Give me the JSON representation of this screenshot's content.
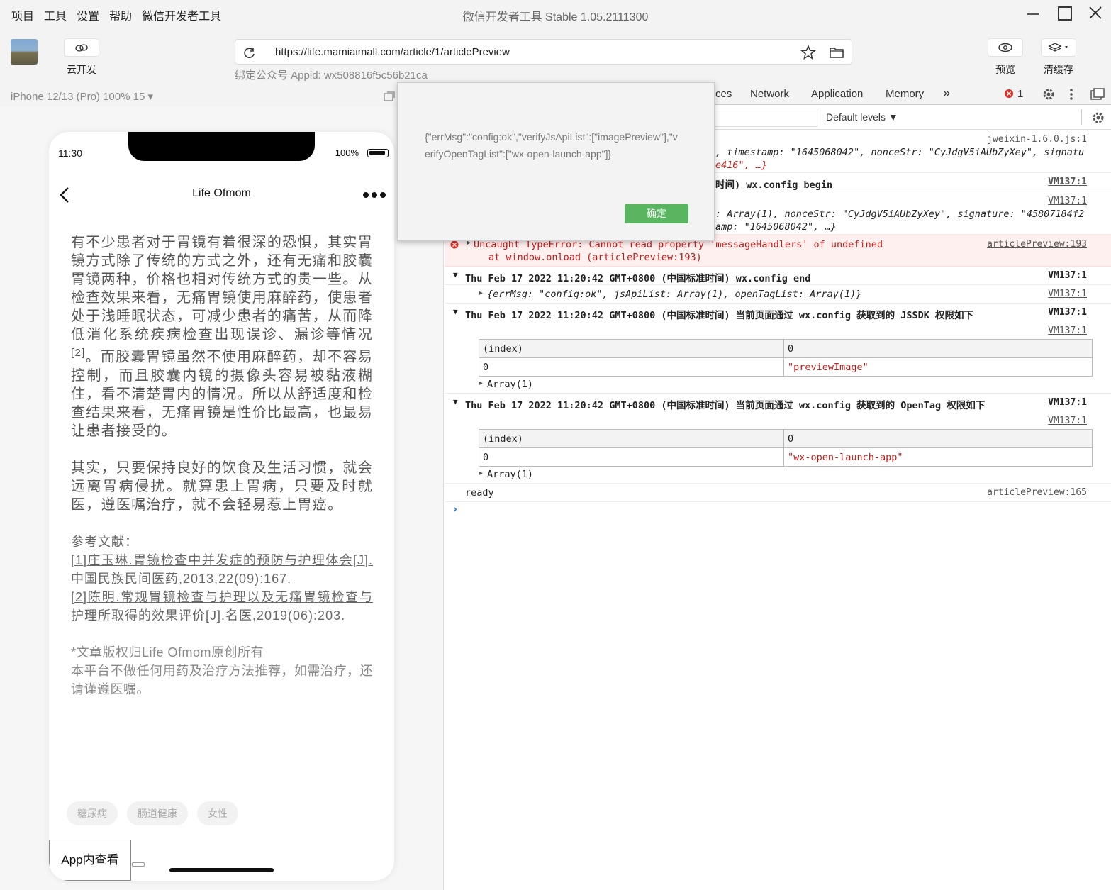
{
  "menu": [
    "项目",
    "工具",
    "设置",
    "帮助",
    "微信开发者工具"
  ],
  "window_title": "微信开发者工具 Stable 1.05.2111300",
  "toolbar": {
    "cloud_label": "云开发",
    "url": "https://life.mamiaimall.com/article/1/articlePreview",
    "appid": "绑定公众号 Appid: wx508816f5c56b21ca",
    "preview_label": "预览",
    "clear_cache_label": "清缓存"
  },
  "simulator": {
    "device_label": "iPhone 12/13 (Pro) 100% 15 ▾",
    "time": "11:30",
    "battery": "100%",
    "nav_title": "Life Ofmom",
    "paragraph1": "有不少患者对于胃镜有着很深的恐惧，其实胃镜方式除了传统的方式之外，还有无痛和胶囊胃镜两种，价格也相对传统方式的贵一些。从检查效果来看，无痛胃镜使用麻醉药，使患者处于浅睡眠状态，可减少患者的痛苦，从而降低消化系统疾病检查出现误诊、漏诊等情况",
    "paragraph1_sup": "[2]",
    "paragraph1_tail": "。而胶囊胃镜虽然不使用麻醉药，却不容易控制，而且胶囊内镜的摄像头容易被黏液糊住，看不清楚胃内的情况。所以从舒适度和检查结果来看，无痛胃镜是性价比最高，也最易让患者接受的。",
    "paragraph2": "其实，只要保持良好的饮食及生活习惯，就会远离胃病侵扰。就算患上胃病，只要及时就医，遵医嘱治疗，就不会轻易惹上胃癌。",
    "refs_title": "参考文献：",
    "ref1": "[1]庄玉琳.胃镜检查中并发症的预防与护理体会[J].中国民族民间医药,2013,22(09):167.",
    "ref2": "[2]陈明.常规胃镜检查与护理以及无痛胃镜检查与护理所取得的效果评价[J].名医,2019(06):203.",
    "copyright": "*文章版权归Life Ofmom原创所有",
    "disclaimer": "本平台不做任何用药及治疗方法推荐，如需治疗，还请谨遵医嘱。",
    "tags": [
      "糖尿病",
      "肠道健康",
      "女性"
    ],
    "app_button": "App内查看"
  },
  "dialog": {
    "message": "{\"errMsg\":\"config:ok\",\"verifyJsApiList\":[\"imagePreview\"],\"verifyOpenTagList\":[\"wx-open-launch-app\"]}",
    "ok": "确定"
  },
  "devtools": {
    "tabs": [
      "ces",
      "Network",
      "Application",
      "Memory",
      "»"
    ],
    "error_count": "1",
    "default_levels": "Default levels ▼",
    "logs": {
      "l1_src": "jweixin-1.6.0.js:1",
      "l1_text": ", timestamp: \"1645068042\", nonceStr: \"CyJdgV5iAUbZyXey\", signatu",
      "l1_text2": "e416\", …}",
      "l2_text": "时间) wx.config begin",
      "l2_src": "VM137:1",
      "l3_src": "VM137:1",
      "l3_text": ": Array(1), nonceStr: \"CyJdgV5iAUbZyXey\", signature: \"45807184f2",
      "l3_text2": "amp: \"1645068042\", …}",
      "err_text": "Uncaught TypeError: Cannot read property 'messageHandlers' of undefined",
      "err_text2": "at window.onload (articlePreview:193)",
      "err_src": "articlePreview:193",
      "end_text": "Thu Feb 17 2022 11:20:42 GMT+0800 (中国标准时间) wx.config end",
      "end_src": "VM137:1",
      "obj_text": "{errMsg: \"config:ok\", jsApiList: Array(1), openTagList: Array(1)}",
      "obj_src": "VM137:1",
      "jssdk_text": "Thu Feb 17 2022 11:20:42 GMT+0800 (中国标准时间) 当前页面通过 wx.config 获取到的 JSSDK 权限如下",
      "jssdk_src": "VM137:1",
      "jssdk_src2": "VM137:1",
      "table1": [
        [
          "(index)",
          "0"
        ],
        [
          "0",
          "\"previewImage\""
        ]
      ],
      "array_label": "Array(1)",
      "opentag_text": "Thu Feb 17 2022 11:20:42 GMT+0800 (中国标准时间) 当前页面通过 wx.config 获取到的 OpenTag 权限如下",
      "opentag_src": "VM137:1",
      "opentag_src2": "VM137:1",
      "table2": [
        [
          "(index)",
          "0"
        ],
        [
          "0",
          "\"wx-open-launch-app\""
        ]
      ],
      "ready_text": "ready",
      "ready_src": "articlePreview:165"
    }
  },
  "colors": {
    "ok_green": "#5ab560",
    "error_red": "#c41a16"
  }
}
